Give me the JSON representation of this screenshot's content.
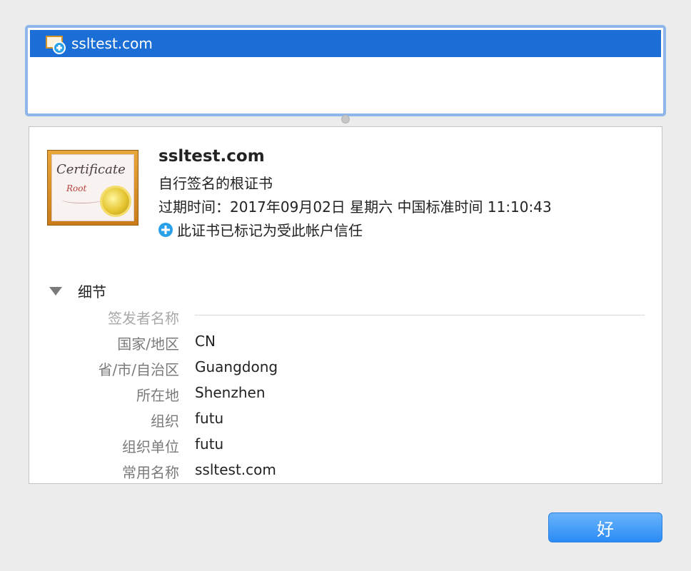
{
  "cert_list": {
    "items": [
      {
        "label": "ssltest.com",
        "icon": "certificate-add-icon",
        "selected": true
      }
    ]
  },
  "certificate": {
    "image_title": "Certificate",
    "image_subtitle": "Root",
    "name": "ssltest.com",
    "type": "自行签名的根证书",
    "expires": "过期时间：2017年09月02日 星期六 中国标准时间 11:10:43",
    "trust": "此证书已标记为受此帐户信任"
  },
  "details": {
    "toggle_label": "细节",
    "section_title": "签发者名称",
    "fields": [
      {
        "key": "国家/地区",
        "value": "CN"
      },
      {
        "key": "省/市/自治区",
        "value": "Guangdong"
      },
      {
        "key": "所在地",
        "value": "Shenzhen"
      },
      {
        "key": "组织",
        "value": "futu"
      },
      {
        "key": "组织单位",
        "value": "futu"
      },
      {
        "key": "常用名称",
        "value": "ssltest.com"
      }
    ]
  },
  "buttons": {
    "ok": "好"
  },
  "colors": {
    "selection": "#1a6ed6",
    "accent": "#2aa0e8",
    "button": "#2a8cf5"
  }
}
